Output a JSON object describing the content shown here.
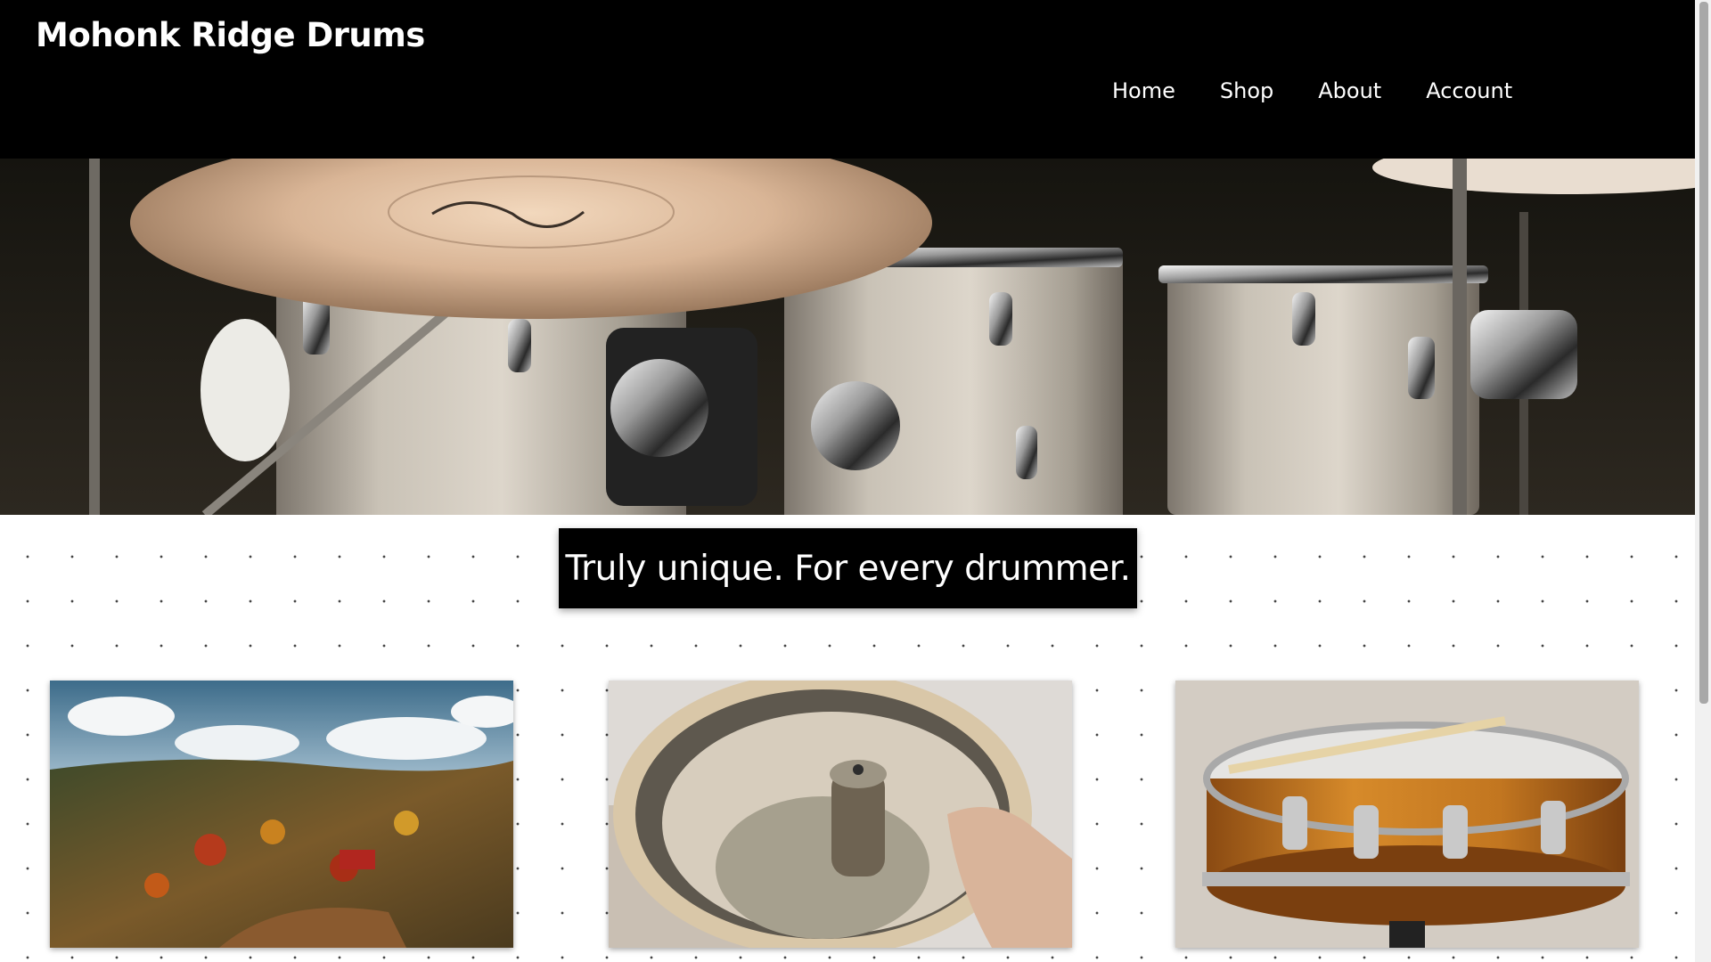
{
  "header": {
    "brand": "Mohonk Ridge Drums",
    "nav": [
      {
        "label": "Home"
      },
      {
        "label": "Shop"
      },
      {
        "label": "About"
      },
      {
        "label": "Account"
      }
    ]
  },
  "hero": {
    "tagline": "Truly unique. For every drummer."
  },
  "colors": {
    "header_bg": "#000000",
    "tagline_bg": "#000000",
    "text": "#ffffff",
    "page_bg": "#ffffff"
  },
  "icons": {
    "hero_image": "drum-kit-photo",
    "card_images": [
      "autumn-farm-landscape-photo",
      "drum-shell-sanding-photo",
      "snare-drum-photo"
    ]
  }
}
